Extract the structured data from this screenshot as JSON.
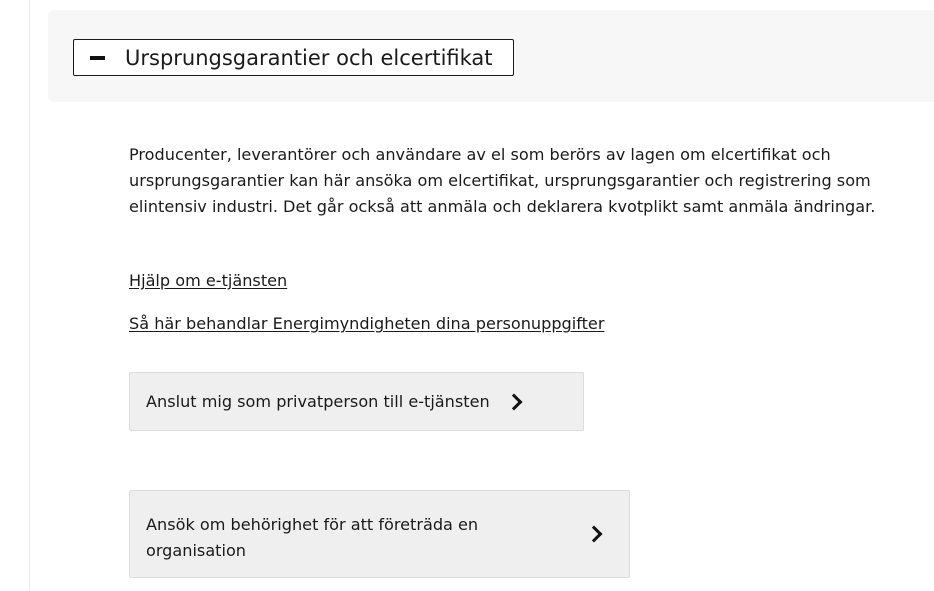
{
  "accordion": {
    "title": "Ursprungsgarantier och elcertifikat",
    "toggle_icon": "minus-icon",
    "expanded": true
  },
  "content": {
    "description": "Producenter, leverantörer och användare av el som berörs av lagen om elcertifikat och ursprungsgarantier kan här ansöka om elcertifikat, ursprungsgarantier och registrering som elintensiv industri. Det går också att anmäla och deklarera kvotplikt samt anmäla ändringar.",
    "links": [
      {
        "label": "Hjälp om e-tjänsten"
      },
      {
        "label": "Så här behandlar Energimyndigheten dina personuppgifter"
      }
    ],
    "buttons": [
      {
        "label": "Anslut mig som privatperson till e-tjänsten",
        "icon": "chevron-right-icon"
      },
      {
        "label": "Ansök om behörighet för att företräda en organisation",
        "icon": "chevron-right-icon"
      }
    ]
  },
  "colors": {
    "header_background": "#f7f7f7",
    "button_background": "#efefef",
    "text": "#1a1a1a"
  }
}
